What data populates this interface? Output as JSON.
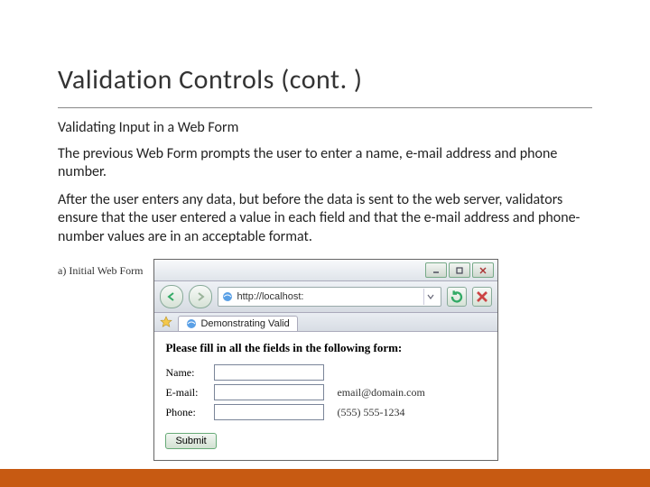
{
  "title": "Validation Controls (cont. )",
  "subtitle": "Validating Input in a Web Form",
  "para1": "The previous Web Form prompts the user to enter a name, e-mail address and phone number.",
  "para2": "After the user enters any data, but before the data is sent to the web server, validators ensure that the user entered a value in each field and that the e-mail address and phone-number values are in an acceptable format.",
  "figure": {
    "caption": "a) Initial Web Form",
    "address": "http://localhost:",
    "tab": "Demonstrating Valid",
    "heading": "Please fill in all the fields in the following form:",
    "fields": {
      "name": {
        "label": "Name:",
        "hint": ""
      },
      "email": {
        "label": "E-mail:",
        "hint": "email@domain.com"
      },
      "phone": {
        "label": "Phone:",
        "hint": "(555) 555-1234"
      }
    },
    "submit": "Submit"
  }
}
